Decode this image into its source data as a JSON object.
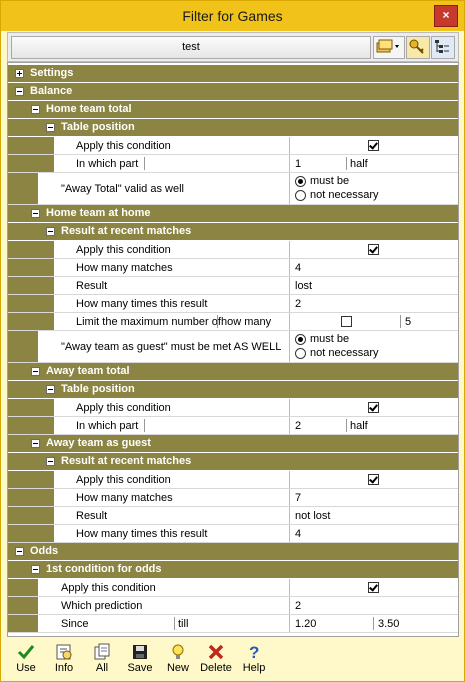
{
  "window": {
    "title": "Filter for Games",
    "close_label": "×"
  },
  "toolbar": {
    "filter_name": "test"
  },
  "tree": {
    "settings": "Settings",
    "balance": "Balance",
    "home_total": {
      "label": "Home team total",
      "table_position": "Table position",
      "apply": "Apply this condition",
      "in_which_part": "In which part",
      "part_value": "1",
      "part_unit": "half",
      "away_total_valid": "\"Away Total\" valid as well",
      "must_be": "must be",
      "not_necessary": "not necessary"
    },
    "home_at_home": {
      "label": "Home team at home",
      "recent": "Result at recent matches",
      "apply": "Apply this condition",
      "how_many_matches": "How many matches",
      "matches_value": "4",
      "result": "Result",
      "result_value": "lost",
      "how_many_times": "How many times this result",
      "times_value": "2",
      "limit_max": "Limit the maximum number of",
      "how_many": "how many",
      "limit_value": "5",
      "away_guest_must": "\"Away team as guest\" must be met AS WELL",
      "must_be": "must be",
      "not_necessary": "not necessary"
    },
    "away_total": {
      "label": "Away team total",
      "table_position": "Table position",
      "apply": "Apply this condition",
      "in_which_part": "In which part",
      "part_value": "2",
      "part_unit": "half"
    },
    "away_as_guest": {
      "label": "Away team as guest",
      "recent": "Result at recent matches",
      "apply": "Apply this condition",
      "how_many_matches": "How many matches",
      "matches_value": "7",
      "result": "Result",
      "result_value": "not lost",
      "how_many_times": "How many times this result",
      "times_value": "4"
    },
    "odds": {
      "label": "Odds",
      "first_cond": "1st condition for odds",
      "apply": "Apply this condition",
      "which_prediction": "Which prediction",
      "prediction_value": "2",
      "since": "Since",
      "till": "till",
      "since_value": "1.20",
      "till_value": "3.50"
    }
  },
  "buttons": {
    "use": "Use",
    "info": "Info",
    "all": "All",
    "save": "Save",
    "new": "New",
    "delete": "Delete",
    "help": "Help"
  },
  "colors": {
    "section": "#8b8443",
    "title_bar": "#f0c21a",
    "panel": "#fff9c9"
  }
}
